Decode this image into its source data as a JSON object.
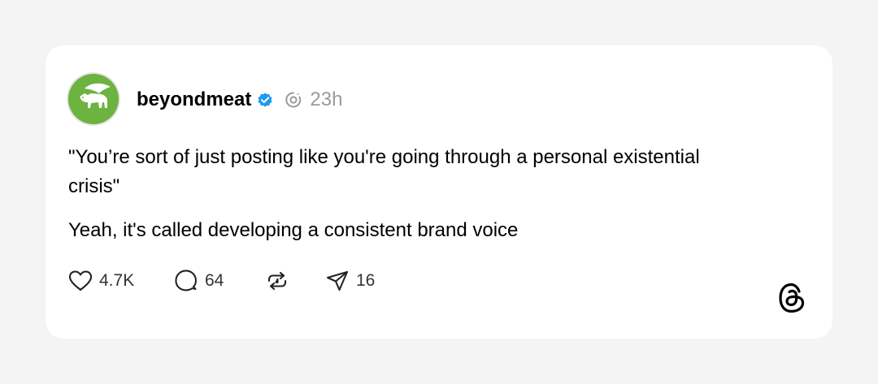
{
  "post": {
    "username": "beyondmeat",
    "verified": true,
    "time": "23h",
    "paragraphs": [
      "\"You’re sort of just posting like you're going through a personal existential crisis\"",
      "Yeah, it's called developing a consistent brand voice"
    ]
  },
  "actions": {
    "likes": "4.7K",
    "replies": "64",
    "shares": "16"
  },
  "icons": {
    "avatar": "beyond-meat-bull-logo",
    "verified": "verified-badge-icon",
    "ai_label": "ai-label-icon",
    "like": "heart-icon",
    "reply": "comment-icon",
    "repost": "repost-icon",
    "share": "send-icon",
    "brand": "threads-logo-icon"
  },
  "colors": {
    "background": "#f4f4f4",
    "card": "#ffffff",
    "avatar_green": "#6cb33f",
    "verified_blue": "#1d9bf0",
    "muted_text": "#9a9a9a"
  }
}
